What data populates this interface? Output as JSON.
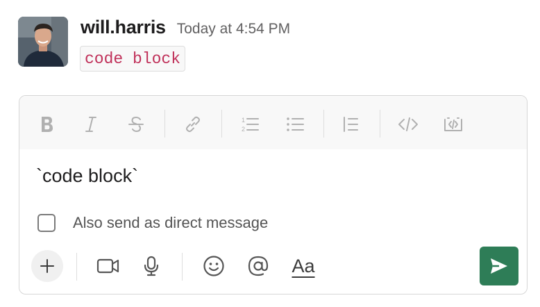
{
  "message": {
    "author": "will.harris",
    "timestamp": "Today at 4:54 PM",
    "code_text": "code block"
  },
  "composer": {
    "format_toolbar": [
      {
        "name": "bold-icon"
      },
      {
        "name": "italic-icon"
      },
      {
        "name": "strikethrough-icon"
      },
      {
        "name": "link-icon"
      },
      {
        "name": "ordered-list-icon"
      },
      {
        "name": "bulleted-list-icon"
      },
      {
        "name": "blockquote-icon"
      },
      {
        "name": "code-icon"
      },
      {
        "name": "code-block-icon"
      }
    ],
    "input_text": "`code block`",
    "also_send_label": "Also send as direct message",
    "also_send_checked": false,
    "actions": [
      {
        "name": "plus-icon"
      },
      {
        "name": "video-icon"
      },
      {
        "name": "microphone-icon"
      },
      {
        "name": "emoji-icon"
      },
      {
        "name": "mention-icon"
      },
      {
        "name": "formatting-icon"
      }
    ],
    "formatting_toggle_label": "Aa",
    "send_icon": "send-icon"
  },
  "colors": {
    "send_button": "#2e7d57",
    "inline_code_text": "#c0315a",
    "toolbar_bg": "#f8f8f8"
  }
}
